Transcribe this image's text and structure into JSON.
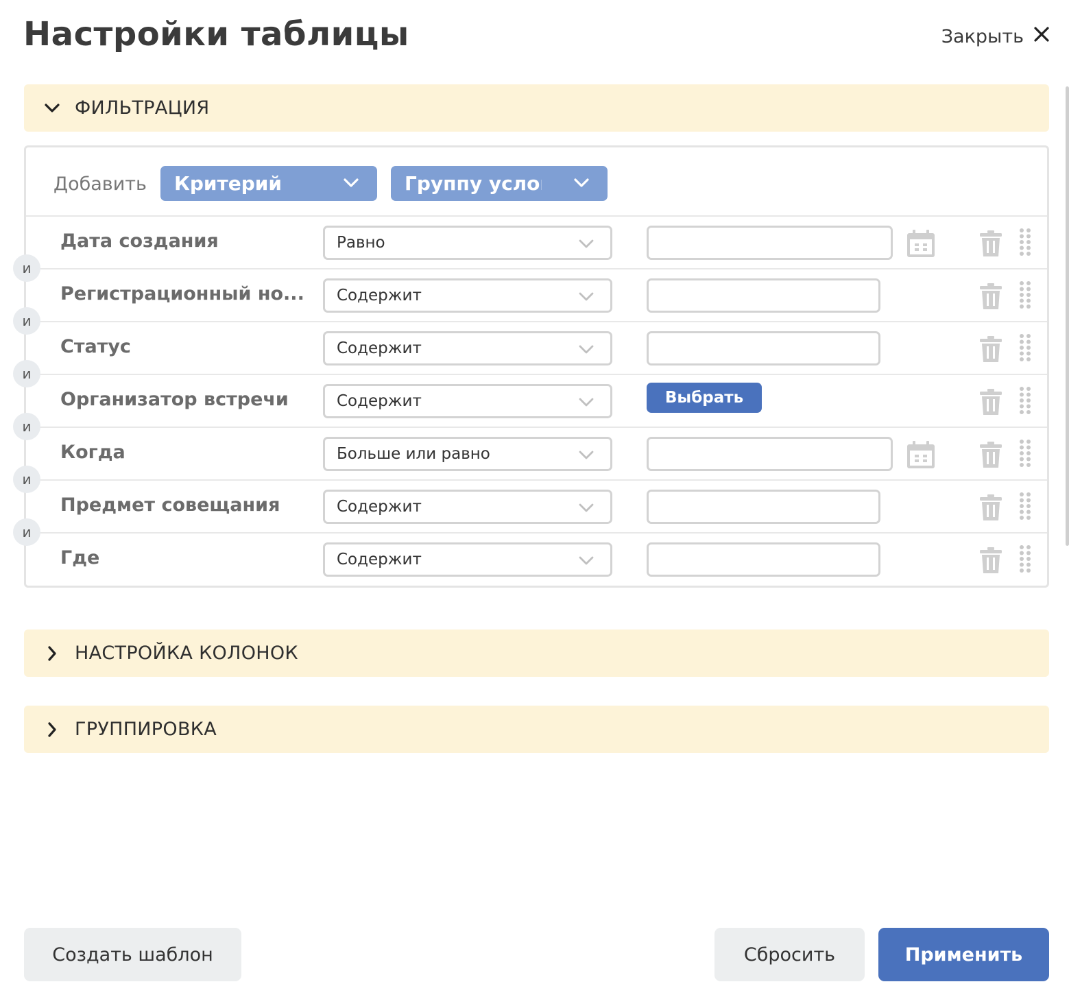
{
  "dialog": {
    "title": "Настройки таблицы",
    "close_label": "Закрыть"
  },
  "sections": {
    "filter": {
      "label": "ФИЛЬТРАЦИЯ",
      "expanded": true
    },
    "columns": {
      "label": "НАСТРОЙКА КОЛОНОК",
      "expanded": false
    },
    "grouping": {
      "label": "ГРУППИРОВКА",
      "expanded": false
    }
  },
  "add_bar": {
    "label": "Добавить",
    "criterion_dropdown": "Критерий",
    "group_dropdown": "Группу условий"
  },
  "connector_label": "И",
  "criteria": [
    {
      "name": "Дата создания",
      "operator": "Равно",
      "value": "",
      "value_type": "date"
    },
    {
      "name": "Регистрационный но...",
      "operator": "Содержит",
      "value": "",
      "value_type": "text"
    },
    {
      "name": "Статус",
      "operator": "Содержит",
      "value": "",
      "value_type": "text"
    },
    {
      "name": "Организатор встречи",
      "operator": "Содержит",
      "value_type": "choose",
      "choose_label": "Выбрать"
    },
    {
      "name": "Когда",
      "operator": "Больше или равно",
      "value": "",
      "value_type": "date"
    },
    {
      "name": "Предмет совещания",
      "operator": "Содержит",
      "value": "",
      "value_type": "text"
    },
    {
      "name": "Где",
      "operator": "Содержит",
      "value": "",
      "value_type": "text"
    }
  ],
  "footer": {
    "create_template": "Создать шаблон",
    "reset": "Сбросить",
    "apply": "Применить"
  },
  "colors": {
    "section_bg": "#fdf3d8",
    "dropdown_bg": "#7f9fd4",
    "primary": "#4a72bd"
  }
}
